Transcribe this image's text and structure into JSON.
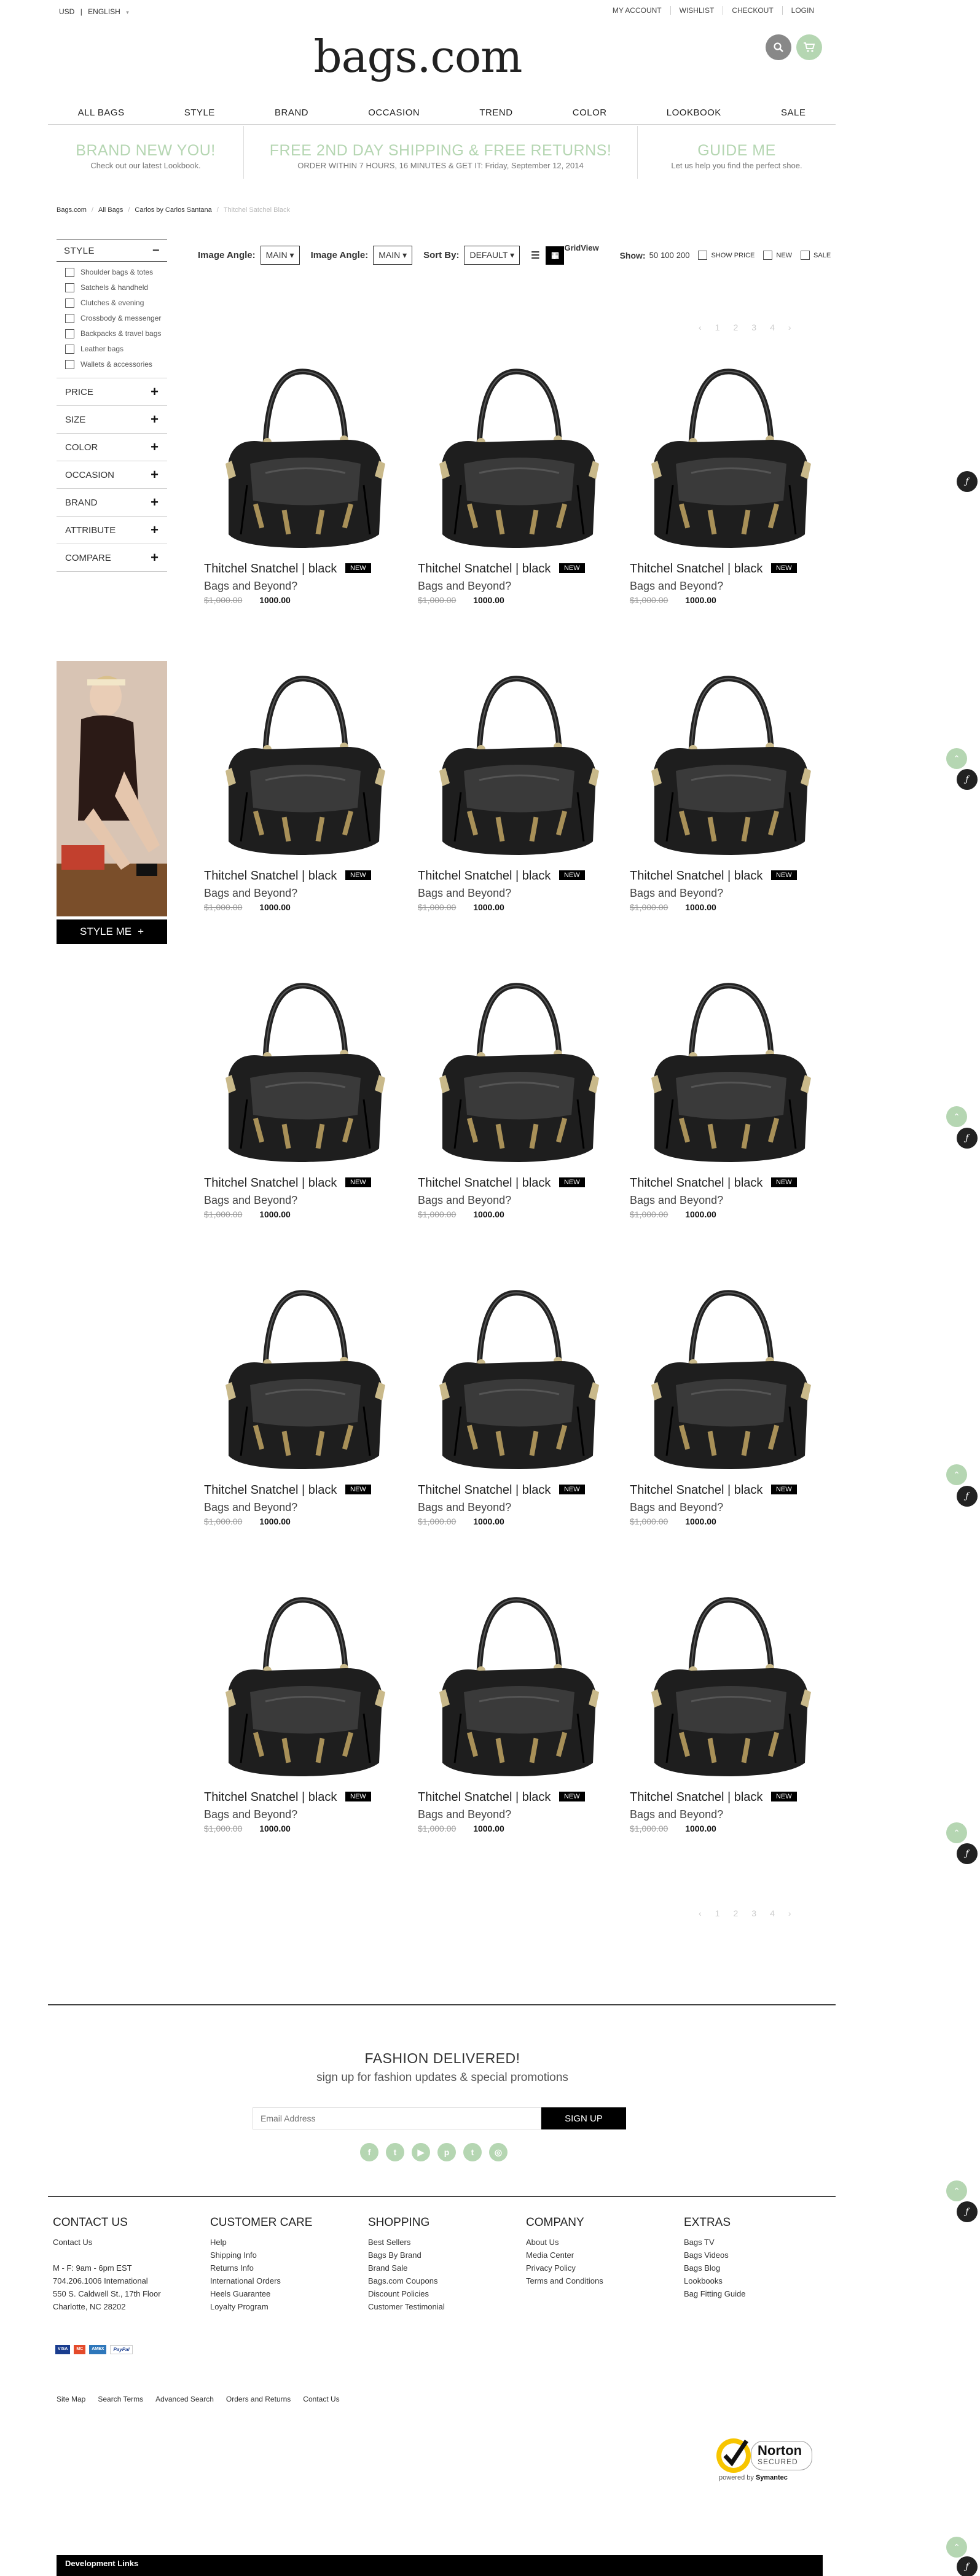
{
  "topbar": {
    "currency": "USD",
    "separator": "|",
    "language": "ENGLISH",
    "links": [
      "MY ACCOUNT",
      "WISHLIST",
      "CHECKOUT",
      "LOGIN"
    ]
  },
  "logo": "bags.com",
  "nav": [
    "ALL BAGS",
    "STYLE",
    "BRAND",
    "OCCASION",
    "TREND",
    "COLOR",
    "LOOKBOOK",
    "SALE"
  ],
  "promos": [
    {
      "title": "BRAND NEW YOU!",
      "sub": "Check out our latest Lookbook."
    },
    {
      "title": "FREE 2ND DAY SHIPPING & FREE RETURNS!",
      "sub": "ORDER WITHIN 7 HOURS, 16 MINUTES & GET IT: Friday, September 12, 2014"
    },
    {
      "title": "GUIDE ME",
      "sub": "Let us help you find the perfect shoe."
    }
  ],
  "breadcrumb": [
    "Bags.com",
    "All Bags",
    "Carlos by Carlos Santana",
    "Thitchel Satchel Black"
  ],
  "sidebar": {
    "style_heading": "STYLE",
    "collapse_symbol": "−",
    "style_options": [
      "Shoulder bags & totes",
      "Satchels & handheld",
      "Clutches & evening",
      "Crossbody & messenger",
      "Backpacks & travel bags",
      "Leather bags",
      "Wallets & accessories"
    ],
    "facets": [
      "PRICE",
      "SIZE",
      "COLOR",
      "OCCASION",
      "BRAND",
      "ATTRIBUTE",
      "COMPARE"
    ],
    "expand_symbol": "+",
    "style_me": "STYLE ME"
  },
  "toolbar": {
    "image_angle_label": "Image Angle:",
    "image_angle_value": "MAIN",
    "sort_by_label": "Sort By:",
    "sort_by_value": "DEFAULT",
    "grid_view": "GridView",
    "show_label": "Show:",
    "show_options": [
      "50",
      "100",
      "200"
    ],
    "filters": [
      "SHOW PRICE",
      "NEW",
      "SALE"
    ]
  },
  "pagination": [
    "‹",
    "1",
    "2",
    "3",
    "4",
    "›"
  ],
  "product": {
    "name": "Thitchel Snatchel | black",
    "badge": "NEW",
    "brand": "Bags and Beyond?",
    "old_price": "$1,000.00",
    "price": "1000.00"
  },
  "newsletter": {
    "title": "FASHION DELIVERED!",
    "sub": "sign up for fashion updates & special promotions",
    "placeholder": "Email Address",
    "button": "SIGN UP"
  },
  "social_icons": [
    "facebook-icon",
    "twitter-icon",
    "youtube-icon",
    "pinterest-icon",
    "tumblr-icon",
    "instagram-icon"
  ],
  "social_glyphs": [
    "f",
    "t",
    "▶",
    "p",
    "t",
    "◎"
  ],
  "footer": {
    "contact": {
      "title": "CONTACT US",
      "lines": [
        "Contact Us",
        "",
        "M - F: 9am - 6pm EST",
        "704.206.1006 International",
        "550 S. Caldwell St., 17th Floor",
        "Charlotte, NC 28202"
      ]
    },
    "care": {
      "title": "CUSTOMER CARE",
      "lines": [
        "Help",
        "Shipping Info",
        "Returns Info",
        "International Orders",
        "Heels Guarantee",
        "Loyalty Program"
      ]
    },
    "shopping": {
      "title": "SHOPPING",
      "lines": [
        "Best Sellers",
        "Bags By Brand",
        "Brand Sale",
        "Bags.com Coupons",
        "Discount Policies",
        "Customer Testimonial"
      ]
    },
    "company": {
      "title": "COMPANY",
      "lines": [
        "About Us",
        "Media Center",
        "Privacy Policy",
        "Terms and Conditions"
      ]
    },
    "extras": {
      "title": "EXTRAS",
      "lines": [
        "Bags TV",
        "Bags Videos",
        "Bags Blog",
        "Lookbooks",
        "Bag Fitting Guide"
      ]
    },
    "payments": [
      "VISA",
      "MC",
      "AMEX",
      "PayPal"
    ],
    "bottom_links": [
      "Site Map",
      "Search Terms",
      "Advanced Search",
      "Orders and Returns",
      "Contact Us"
    ],
    "norton": {
      "brand": "Norton",
      "secured": "SECURED",
      "powered": "powered by",
      "symantec": "Symantec"
    },
    "dev_links": "Development Links"
  },
  "colors": {
    "accent_green": "#b5d6b2",
    "dark": "#222222"
  }
}
